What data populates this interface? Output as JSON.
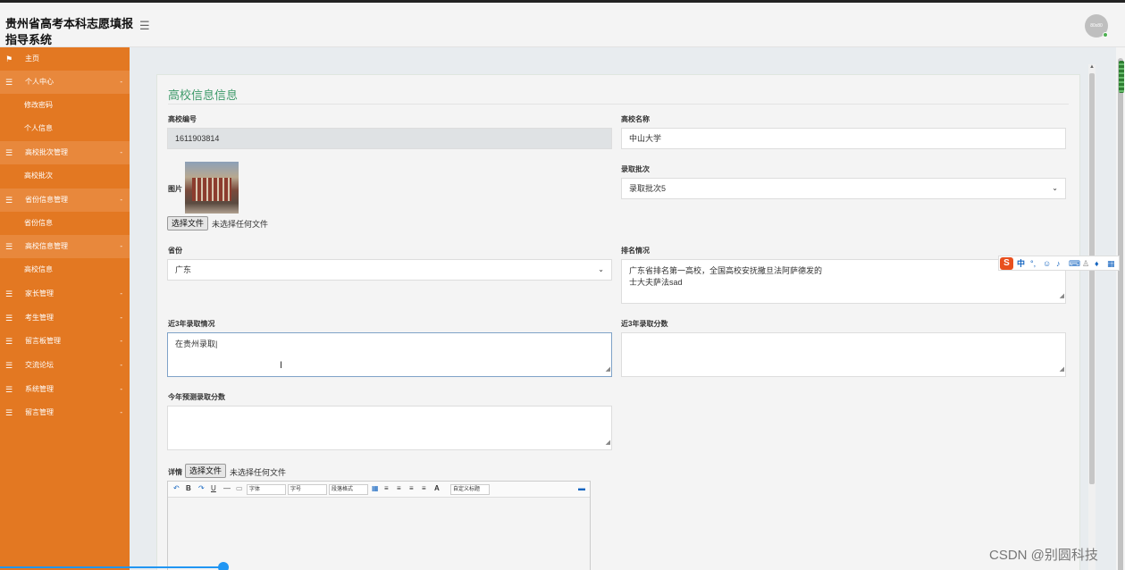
{
  "app": {
    "title": "贵州省高考本科志愿填报指导系统",
    "avatar_text": "80x80"
  },
  "sidebar": {
    "items": [
      {
        "label": "主页",
        "type": "home"
      },
      {
        "label": "个人中心",
        "type": "parent"
      },
      {
        "label": "修改密码",
        "type": "child"
      },
      {
        "label": "个人信息",
        "type": "child"
      },
      {
        "label": "高校批次管理",
        "type": "parent"
      },
      {
        "label": "高校批次",
        "type": "child"
      },
      {
        "label": "省份信息管理",
        "type": "parent"
      },
      {
        "label": "省份信息",
        "type": "child"
      },
      {
        "label": "高校信息管理",
        "type": "parent"
      },
      {
        "label": "高校信息",
        "type": "child"
      },
      {
        "label": "家长管理",
        "type": "item"
      },
      {
        "label": "考生管理",
        "type": "item"
      },
      {
        "label": "留言板管理",
        "type": "item"
      },
      {
        "label": "交流论坛",
        "type": "item"
      },
      {
        "label": "系统管理",
        "type": "item"
      },
      {
        "label": "留言管理",
        "type": "item"
      }
    ]
  },
  "form": {
    "title": "高校信息信息",
    "school_id": {
      "label": "高校编号",
      "value": "1611903814"
    },
    "school_name": {
      "label": "高校名称",
      "value": "中山大学"
    },
    "image": {
      "label": "图片",
      "button": "选择文件",
      "status": "未选择任何文件"
    },
    "batch": {
      "label": "录取批次",
      "value": "录取批次5"
    },
    "province": {
      "label": "省份",
      "value": "广东"
    },
    "ranking": {
      "label": "排名情况",
      "line1": "广东省排名第一高校，全国高校安抚撒旦法阿萨德发的",
      "line2": "士大夫萨法sad"
    },
    "recent_admission": {
      "label": "近3年录取情况",
      "value": "在贵州录取"
    },
    "recent_scores": {
      "label": "近3年录取分数",
      "value": ""
    },
    "predicted_score": {
      "label": "今年预测录取分数",
      "value": ""
    },
    "details": {
      "label": "详情",
      "button": "选择文件",
      "status": "未选择任何文件"
    }
  },
  "editor": {
    "font_family": "字体",
    "font_size": "字号",
    "paragraph": "段落格式",
    "custom_title": "自定义标题"
  },
  "ime": {
    "logo": "S",
    "mode": "中"
  },
  "watermark": "CSDN @别圆科技"
}
